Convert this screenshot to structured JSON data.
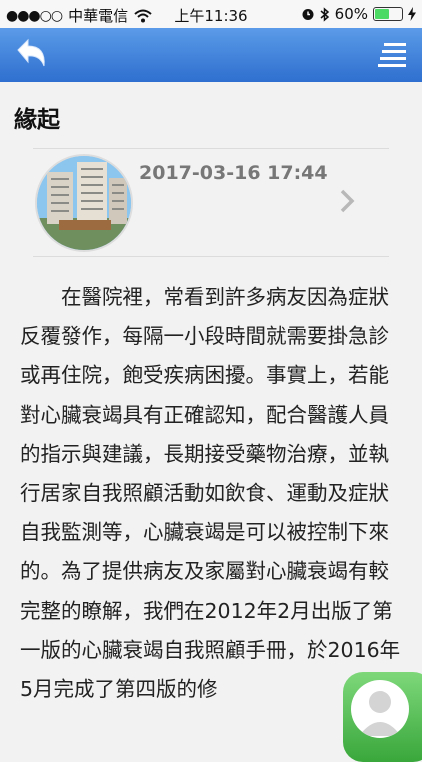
{
  "status_bar": {
    "signal_dots": "●●●○○",
    "carrier": "中華電信",
    "time": "上午11:36",
    "battery_percent": "60%",
    "battery_level": 0.6
  },
  "header": {
    "back_icon": "back-arrow-icon",
    "menu_icon": "list-menu-icon"
  },
  "page": {
    "title": "緣起"
  },
  "article": {
    "date": "2017-03-16 17:44",
    "thumbnail_icon": "hospital-building-image",
    "chevron_icon": "chevron-right-icon"
  },
  "content": {
    "body": "在醫院裡，常看到許多病友因為症狀反覆發作，每隔一小段時間就需要掛急診或再住院，飽受疾病困擾。事實上，若能對心臟衰竭具有正確認知，配合醫護人員的指示與建議，長期接受藥物治療，並執行居家自我照顧活動如飲食、運動及症狀自我監測等，心臟衰竭是可以被控制下來的。為了提供病友及家屬對心臟衰竭有較完整的瞭解，我們在2012年2月出版了第一版的心臟衰竭自我照顧手冊，於2016年5月完成了第四版的修"
  },
  "fab": {
    "icon": "user-avatar-icon"
  }
}
